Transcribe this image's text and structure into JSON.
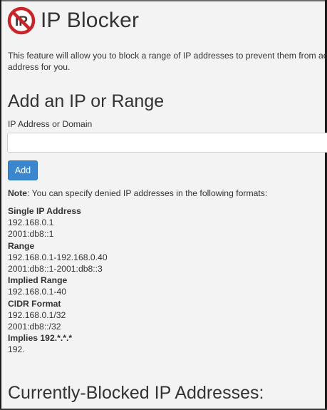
{
  "header": {
    "title": "IP Blocker",
    "logo_icon": "ip-blocker-logo-icon",
    "logo_text": "IP"
  },
  "description": {
    "line1": "This feature will allow you to block a range of IP addresses to prevent them from acce",
    "line2": "address for you."
  },
  "add_section": {
    "title": "Add an IP or Range",
    "field_label": "IP Address or Domain",
    "field_value": "",
    "add_label": "Add"
  },
  "note": {
    "label": "Note",
    "text": ": You can specify denied IP addresses in the following formats:"
  },
  "formats": [
    {
      "heading": "Single IP Address",
      "examples": [
        "192.168.0.1",
        "2001:db8::1"
      ]
    },
    {
      "heading": "Range",
      "examples": [
        "192.168.0.1-192.168.0.40",
        "2001:db8::1-2001:db8::3"
      ]
    },
    {
      "heading": "Implied Range",
      "examples": [
        "192.168.0.1-40"
      ]
    },
    {
      "heading": "CIDR Format",
      "examples": [
        "192.168.0.1/32",
        "2001:db8::/32"
      ]
    },
    {
      "heading": "Implies 192.*.*.*",
      "examples": [
        "192."
      ]
    }
  ],
  "blocked_section": {
    "title": "Currently-Blocked IP Addresses:"
  },
  "colors": {
    "accent": "#3a87cf",
    "logo_red": "#c8252b",
    "background": "#f3f3f3",
    "text": "#333333"
  }
}
